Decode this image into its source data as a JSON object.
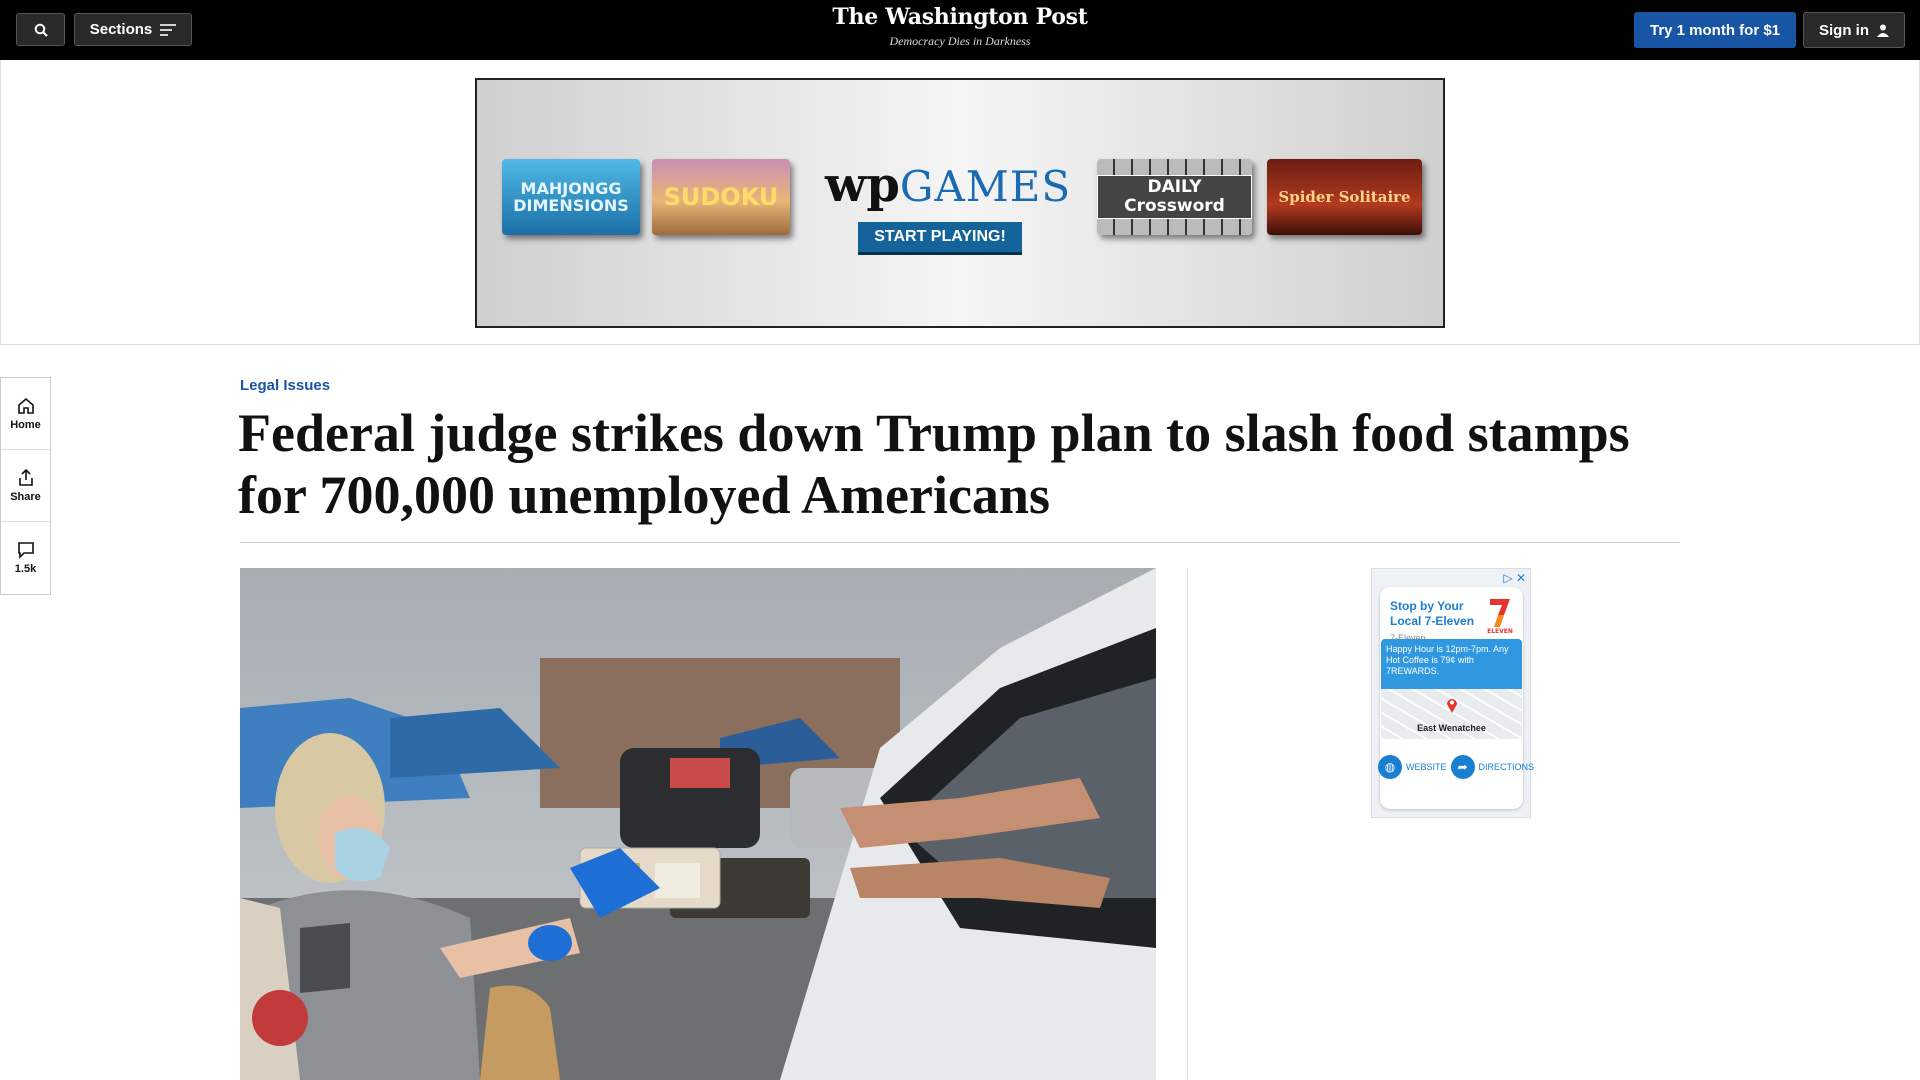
{
  "header": {
    "sections_label": "Sections",
    "logo": "The Washington Post",
    "tagline": "Democracy Dies in Darkness",
    "subscribe_label": "Try 1 month for $1",
    "signin_label": "Sign in"
  },
  "banner_ad": {
    "tiles": {
      "mahjong": "MAHJONGG DIMENSIONS",
      "sudoku": "SUDOKU",
      "crossword": "DAILY Crossword",
      "spider": "Spider Solitaire"
    },
    "wp_mark": "wp",
    "games_word": "GAMES",
    "cta": "START PLAYING!"
  },
  "rail": {
    "home": "Home",
    "share": "Share",
    "comments": "1.5k"
  },
  "article": {
    "kicker": "Legal Issues",
    "headline": "Federal judge strikes down Trump plan to slash food stamps for 700,000 unemployed Americans"
  },
  "side_ad": {
    "title": "Stop by Your Local 7-Eleven",
    "subtitle": "7-Eleven",
    "promo": "Happy Hour is 12pm-7pm. Any Hot Coffee is 79¢ with 7REWARDS.",
    "map_label": "East Wenatchee",
    "website": "WEBSITE",
    "directions": "DIRECTIONS"
  },
  "colors": {
    "brand_blue": "#1955a5",
    "topbar": "#000000"
  }
}
